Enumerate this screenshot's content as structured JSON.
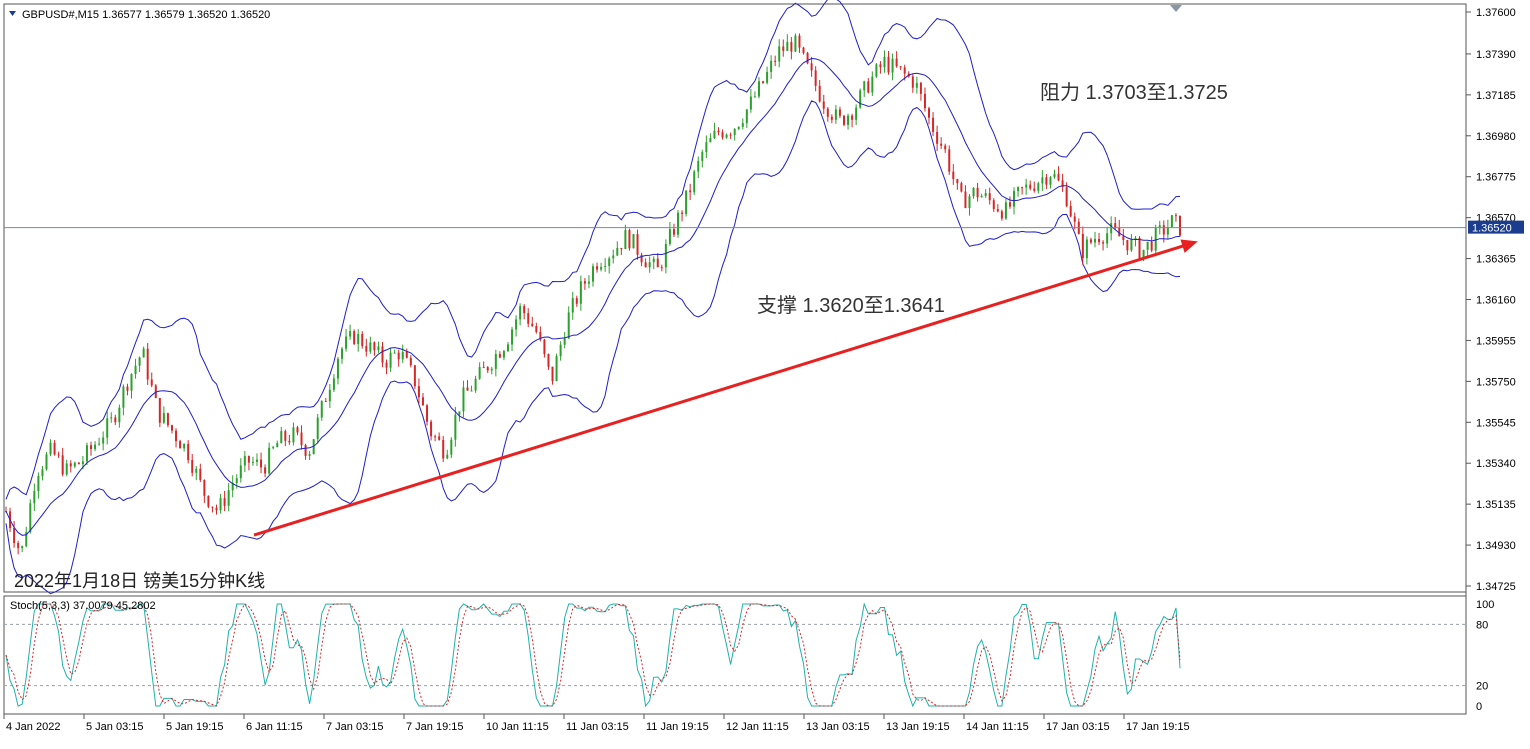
{
  "header": {
    "symbol_line": "GBPUSD#,M15  1.36577 1.36579 1.36520 1.36520",
    "stoch_line": "Stoch(5,3,3) 37.0079 45.2802"
  },
  "caption": "2022年1月18日 镑美15分钟K线",
  "annotations": {
    "resistance": "阻力 1.3703至1.3725",
    "support": "支撑 1.3620至1.3641"
  },
  "colors": {
    "bull": "#2ca02c",
    "bear": "#d62728",
    "band": "#1f1fcc",
    "trendline": "#e82020",
    "stoch_main": "#20b2aa",
    "stoch_signal": "#d62728",
    "grid": "#9aa0a6",
    "price_line": "#7b8a9a",
    "price_tag_bg": "#1a3d8f"
  },
  "chart_data": {
    "type": "candlestick",
    "symbol": "GBPUSD#",
    "timeframe": "M15",
    "ohlc_last": {
      "open": 1.36577,
      "high": 1.36579,
      "low": 1.3652,
      "close": 1.3652
    },
    "current_price": "1.36520",
    "y_axis_ticks": [
      "1.37600",
      "1.37390",
      "1.37185",
      "1.36980",
      "1.36775",
      "1.36570",
      "1.36365",
      "1.36160",
      "1.35955",
      "1.35750",
      "1.35545",
      "1.35340",
      "1.35135",
      "1.34930",
      "1.34725"
    ],
    "ylim": [
      1.34725,
      1.376
    ],
    "x_time_labels": [
      "4 Jan 2022",
      "5 Jan 03:15",
      "5 Jan 19:15",
      "6 Jan 11:15",
      "7 Jan 03:15",
      "7 Jan 19:15",
      "10 Jan 11:15",
      "11 Jan 03:15",
      "11 Jan 19:15",
      "12 Jan 11:15",
      "13 Jan 03:15",
      "13 Jan 19:15",
      "14 Jan 11:15",
      "17 Jan 03:15",
      "17 Jan 19:15"
    ],
    "price_path": [
      [
        0,
        1.351
      ],
      [
        2,
        1.3488
      ],
      [
        4,
        1.353
      ],
      [
        6,
        1.354
      ],
      [
        8,
        1.353
      ],
      [
        10,
        1.3535
      ],
      [
        12,
        1.3545
      ],
      [
        14,
        1.3555
      ],
      [
        16,
        1.3575
      ],
      [
        18,
        1.359
      ],
      [
        20,
        1.356
      ],
      [
        22,
        1.355
      ],
      [
        24,
        1.354
      ],
      [
        26,
        1.352
      ],
      [
        28,
        1.351
      ],
      [
        30,
        1.3525
      ],
      [
        32,
        1.3535
      ],
      [
        34,
        1.3532
      ],
      [
        36,
        1.3545
      ],
      [
        38,
        1.3548
      ],
      [
        40,
        1.354
      ],
      [
        42,
        1.3565
      ],
      [
        44,
        1.359
      ],
      [
        46,
        1.3598
      ],
      [
        48,
        1.3592
      ],
      [
        50,
        1.3585
      ],
      [
        52,
        1.359
      ],
      [
        54,
        1.3575
      ],
      [
        56,
        1.355
      ],
      [
        58,
        1.354
      ],
      [
        60,
        1.3565
      ],
      [
        62,
        1.3575
      ],
      [
        64,
        1.3585
      ],
      [
        66,
        1.3595
      ],
      [
        68,
        1.3612
      ],
      [
        70,
        1.36
      ],
      [
        72,
        1.3575
      ],
      [
        74,
        1.3605
      ],
      [
        76,
        1.3622
      ],
      [
        78,
        1.3635
      ],
      [
        80,
        1.364
      ],
      [
        82,
        1.3648
      ],
      [
        84,
        1.3638
      ],
      [
        86,
        1.363
      ],
      [
        88,
        1.365
      ],
      [
        90,
        1.3668
      ],
      [
        92,
        1.369
      ],
      [
        94,
        1.37
      ],
      [
        96,
        1.3702
      ],
      [
        98,
        1.3712
      ],
      [
        100,
        1.3725
      ],
      [
        102,
        1.374
      ],
      [
        104,
        1.3745
      ],
      [
        106,
        1.373
      ],
      [
        108,
        1.3715
      ],
      [
        110,
        1.3705
      ],
      [
        112,
        1.3712
      ],
      [
        114,
        1.3725
      ],
      [
        116,
        1.3735
      ],
      [
        118,
        1.373
      ],
      [
        120,
        1.3725
      ],
      [
        122,
        1.3705
      ],
      [
        124,
        1.369
      ],
      [
        126,
        1.3665
      ],
      [
        128,
        1.367
      ],
      [
        130,
        1.3665
      ],
      [
        132,
        1.366
      ],
      [
        134,
        1.367
      ],
      [
        136,
        1.3675
      ],
      [
        138,
        1.368
      ],
      [
        140,
        1.3668
      ],
      [
        142,
        1.364
      ],
      [
        144,
        1.3648
      ],
      [
        146,
        1.365
      ],
      [
        148,
        1.3645
      ],
      [
        150,
        1.364
      ],
      [
        152,
        1.3648
      ],
      [
        154,
        1.3655
      ],
      [
        155,
        1.3652
      ]
    ],
    "trendline": {
      "from": [
        "6 Jan 11:15",
        1.3498
      ],
      "to": [
        "17 Jan 19:15",
        1.36445
      ]
    },
    "support_zone": [
      1.362,
      1.3641
    ],
    "resistance_zone": [
      1.3703,
      1.3725
    ],
    "indicator": {
      "name": "Stoch(5,3,3)",
      "main": 37.0079,
      "signal": 45.2802,
      "levels": [
        80,
        20
      ],
      "axis_ticks": [
        "100",
        "80",
        "20",
        "0"
      ]
    }
  }
}
